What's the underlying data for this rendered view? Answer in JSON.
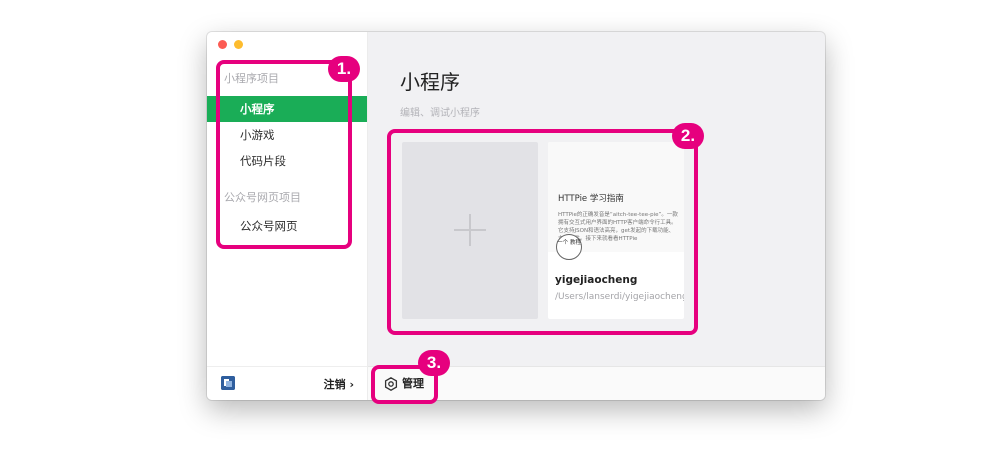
{
  "sidebar": {
    "section1_title": "小程序项目",
    "items": [
      {
        "label": "小程序"
      },
      {
        "label": "小游戏"
      },
      {
        "label": "代码片段"
      }
    ],
    "section2_title": "公众号网页项目",
    "items2": [
      {
        "label": "公众号网页"
      }
    ],
    "logout_label": "注销 ›"
  },
  "main": {
    "title": "小程序",
    "subtitle": "编辑、调试小程序",
    "project": {
      "thumb_title": "HTTPie 学习指南",
      "thumb_text": "HTTPie的正确发音是“aitch-tee-tee-pie”。一款拥有交互式用户界面的HTTP客户端命令行工具。它支持JSON和语法高亮，get发起的下载功能、支持插件。接下来就看看HTTPie",
      "seal_text": "一个 教程",
      "name": "yigejiaocheng",
      "path": "/Users/lanserdi/yigejiaocheng"
    }
  },
  "footer": {
    "manage_label": "管理"
  },
  "annotations": {
    "badge1": "1.",
    "badge2": "2.",
    "badge3": "3."
  },
  "colors": {
    "accent_green": "#1aad57",
    "annotation_pink": "#e6007e"
  }
}
